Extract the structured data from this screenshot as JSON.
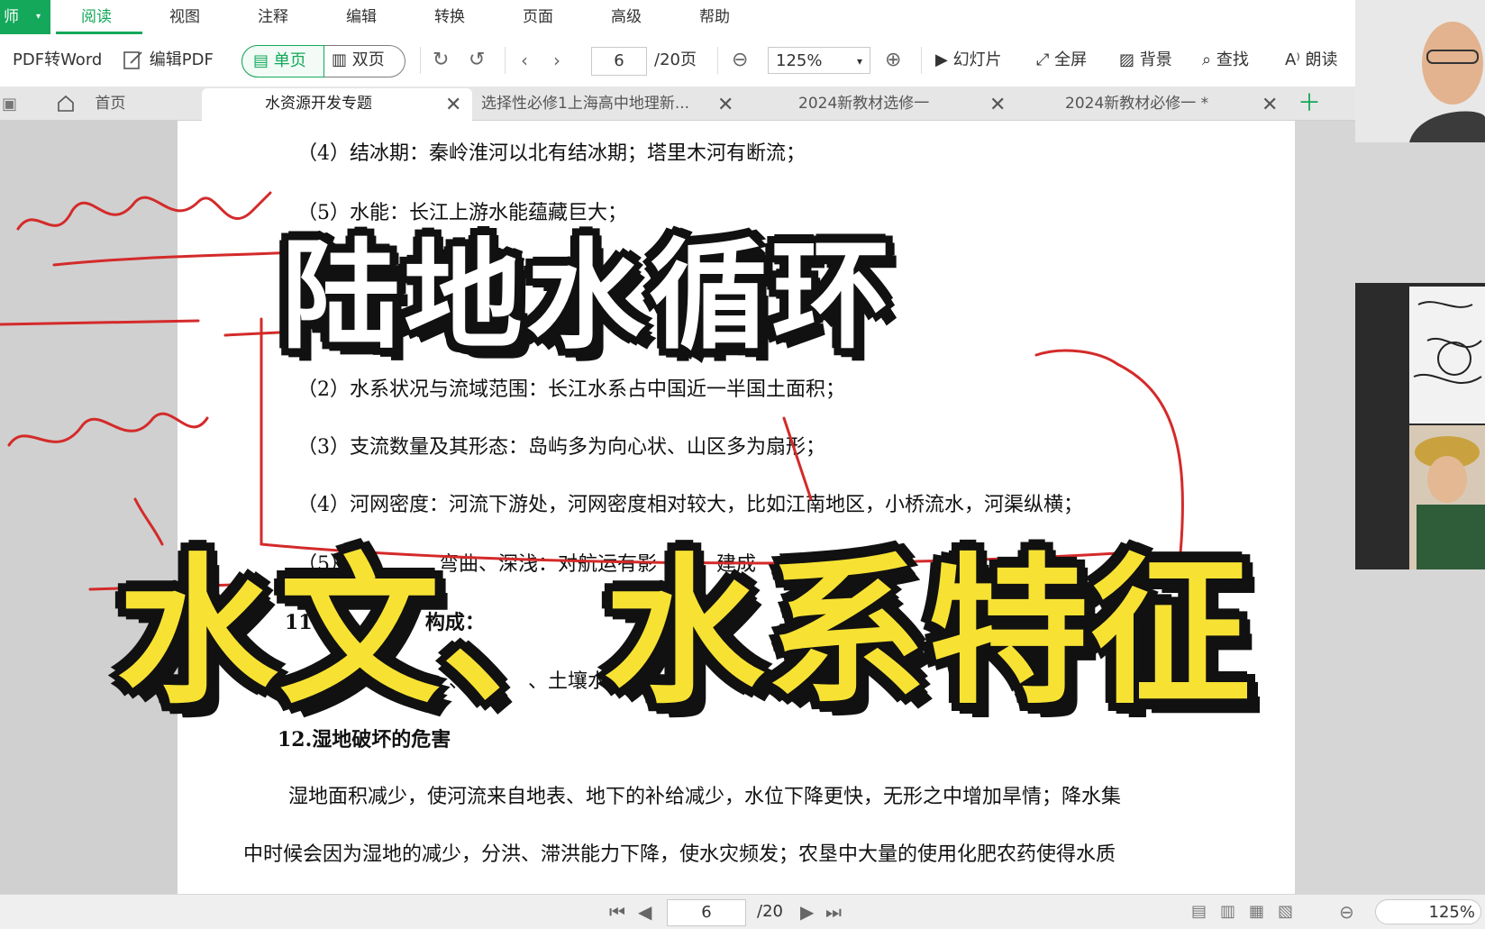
{
  "app": {
    "badge": "师"
  },
  "menu": [
    "阅读",
    "视图",
    "注释",
    "编辑",
    "转换",
    "页面",
    "高级",
    "帮助"
  ],
  "toolbar": {
    "pdf_to_word": "PDF转Word",
    "edit_pdf": "编辑PDF",
    "single_page": "单页",
    "double_page": "双页",
    "page_current": "6",
    "page_total": "/20页",
    "zoom": "125%",
    "slideshow": "幻灯片",
    "fullscreen": "全屏",
    "background": "背景",
    "find": "查找",
    "read_aloud": "朗读"
  },
  "tabs": {
    "home": "首页",
    "items": [
      "水资源开发专题",
      "选择性必修1上海高中地理新...",
      "2024新教材选修一",
      "2024新教材必修一 *"
    ]
  },
  "document": {
    "lines": [
      "（4）结冰期：秦岭淮河以北有结冰期；塔里木河有断流；",
      "（5）水能：长江上游水能蕴藏巨大；",
      "（2）水系状况与流域范围：长江水系占中国近一半国土面积；",
      "（3）支流数量及其形态：岛屿多为向心状、山区多为扇形；",
      "（4）河网密度：河流下游处，河网密度相对较大，比如江南地区，小桥流水，河渠纵横；",
      "（5）　　　　　弯曲、深浅：对航运有影　　　建成　　　　巨轮",
      "11. 陆　　　　构成：",
      "河　　、湖　　、沼　　、土壤水、地　　　　　等。",
      "12.湿地破坏的危害",
      "湿地面积减少，使河流来自地表、地下的补给减少，水位下降更快，无形之中增加旱情；降水集",
      "中时候会因为湿地的减少，分洪、滞洪能力下降，使水灾频发；农垦中大量的使用化肥农药使得水质"
    ]
  },
  "overlay": {
    "title_top": "陆地水循环",
    "title_bottom": "水文、水系特征"
  },
  "statusbar": {
    "page_current": "6",
    "page_total": "/20",
    "zoom": "125%"
  },
  "colors": {
    "accent": "#13a85a",
    "ink_red": "#d42a2a",
    "title_yellow": "#f7e233"
  }
}
